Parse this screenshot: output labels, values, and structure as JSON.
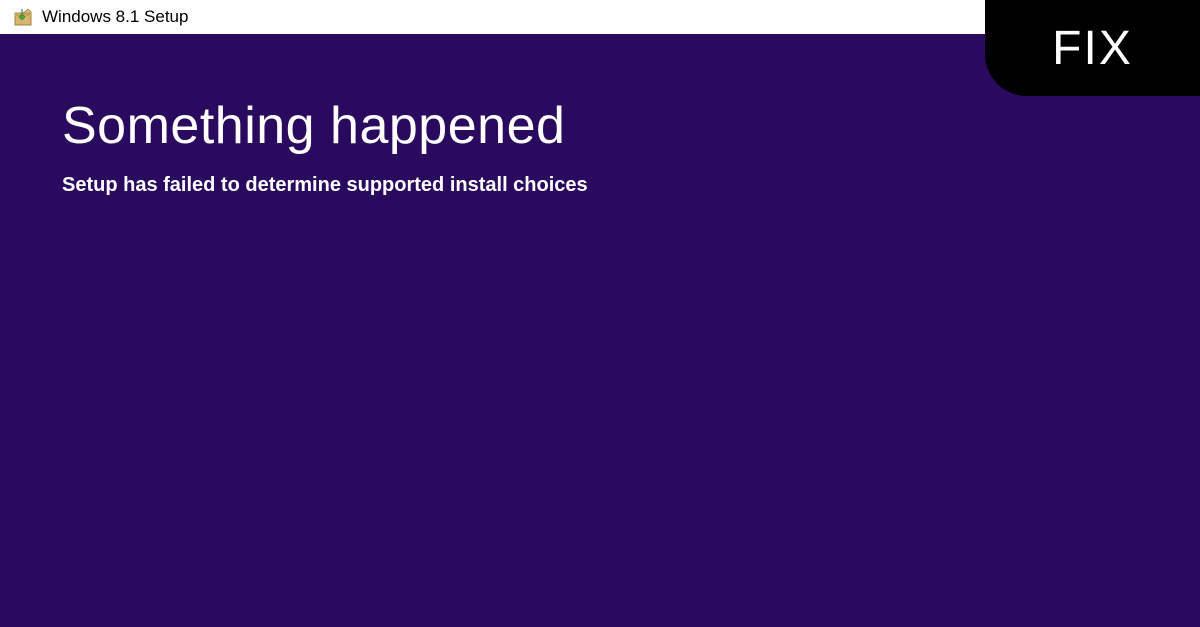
{
  "titlebar": {
    "icon_name": "setup-box-icon",
    "title": "Windows 8.1 Setup"
  },
  "main": {
    "heading": "Something happened",
    "message": "Setup has failed to determine supported install choices"
  },
  "overlay": {
    "fix_label": "FIX"
  },
  "colors": {
    "background": "#2a0a5e",
    "titlebar_bg": "#ffffff",
    "text_light": "#ffffff",
    "badge_bg": "#000000"
  }
}
